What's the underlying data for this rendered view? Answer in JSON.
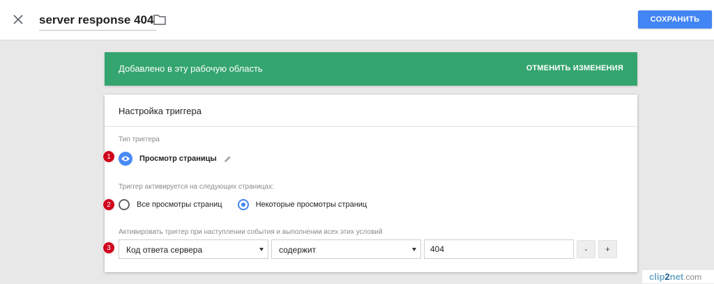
{
  "header": {
    "title": "server response 404",
    "save_label": "СОХРАНИТЬ"
  },
  "banner": {
    "text": "Добавлено в эту рабочую область",
    "undo_label": "ОТМЕНИТЬ ИЗМЕНЕНИЯ",
    "color": "#34a56f"
  },
  "card": {
    "title": "Настройка триггера",
    "trigger_type_label": "Тип триггера",
    "trigger_type_value": "Просмотр страницы",
    "fires_on_label": "Триггер активируется на следующих страницах:",
    "radio_options": [
      {
        "label": "Все просмотры страниц",
        "checked": false
      },
      {
        "label": "Некоторые просмотры страниц",
        "checked": true
      }
    ],
    "condition_label": "Активировать триггер при наступлении события и выполнении всех этих условий",
    "condition": {
      "variable": "Код ответа сервера",
      "operator": "содержит",
      "value": "404",
      "minus_label": "-",
      "plus_label": "+"
    }
  },
  "badges": [
    "1",
    "2",
    "3"
  ],
  "watermark": {
    "part1": "clip",
    "part2": "2",
    "part3": "net",
    "part4": ".com"
  },
  "icons": {
    "close": "close-icon",
    "folder": "folder-icon",
    "eye": "eye-icon",
    "pencil": "pencil-icon"
  },
  "colors": {
    "accent": "#4285f4",
    "badge": "#d0021b"
  }
}
